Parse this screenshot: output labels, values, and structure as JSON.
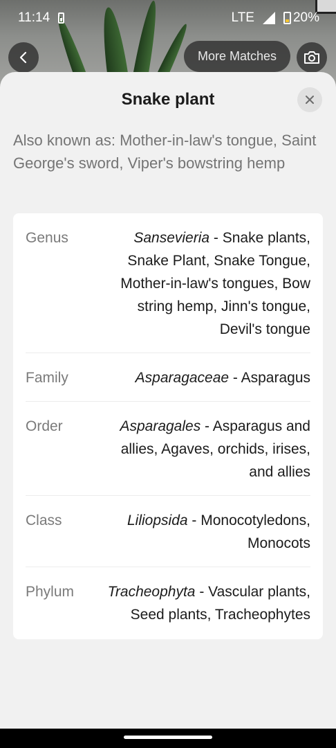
{
  "status_bar": {
    "time": "11:14",
    "network": "LTE",
    "battery": "20%"
  },
  "top_controls": {
    "back_icon": "chevron-left-icon",
    "more_matches_label": "More Matches",
    "camera_icon": "camera-icon"
  },
  "sheet": {
    "title": "Snake plant",
    "close_icon": "close-icon",
    "also_known_as": "Also known as: Mother-in-law's tongue, Saint George's sword, Viper's bowstring hemp",
    "taxonomy": [
      {
        "rank": "Genus",
        "scientific": "Sansevieria",
        "common": " - Snake plants, Snake Plant, Snake Tongue, Mother-in-law's tongues, Bow string hemp, Jinn's tongue, Devil's tongue"
      },
      {
        "rank": "Family",
        "scientific": "Asparagaceae",
        "common": " - Asparagus"
      },
      {
        "rank": "Order",
        "scientific": "Asparagales",
        "common": " - Asparagus and allies, Agaves, orchids, irises, and allies"
      },
      {
        "rank": "Class",
        "scientific": "Liliopsida",
        "common": " - Monocotyledons, Monocots"
      },
      {
        "rank": "Phylum",
        "scientific": "Tracheophyta",
        "common": " - Vascular plants, Seed plants, Tracheophytes"
      }
    ]
  }
}
